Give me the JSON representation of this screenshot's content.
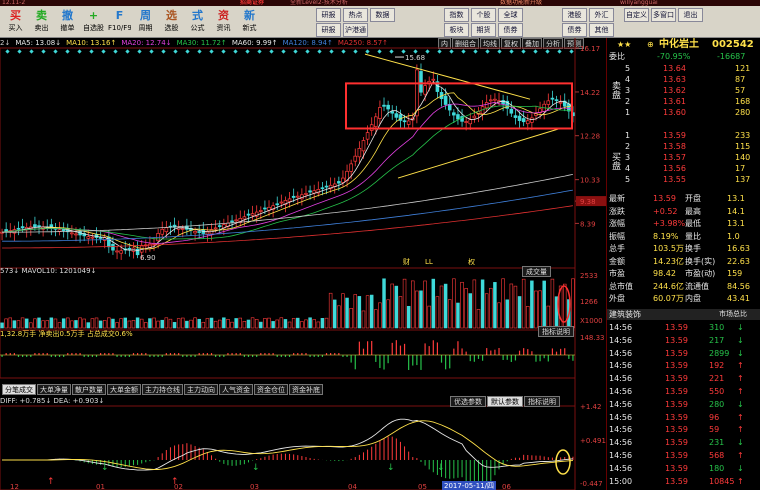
{
  "titlebar": {
    "left": "12.11-2",
    "brand": "招商证券",
    "app_name": "全新Level2-技术分析",
    "center_text": "数据功能新升级",
    "user": "willyangguai"
  },
  "menu": [
    "交易",
    "智能",
    "工具",
    "资讯",
    "帮助"
  ],
  "toolbar": {
    "buttons": [
      {
        "label": "买入",
        "icon": "买"
      },
      {
        "label": "卖出",
        "icon": "卖"
      },
      {
        "label": "撤单",
        "icon": "撤"
      },
      {
        "label": "自选股",
        "icon": "+"
      },
      {
        "label": "F10/F9",
        "icon": "F"
      },
      {
        "label": "周期",
        "icon": "周"
      },
      {
        "label": "选股",
        "icon": "选"
      },
      {
        "label": "公式",
        "icon": "式"
      },
      {
        "label": "资讯",
        "icon": "资"
      },
      {
        "label": "新式",
        "icon": "新"
      }
    ],
    "group2": [
      "研报",
      "热点",
      "数据",
      "研报",
      "沪港通"
    ],
    "group3": [
      "指数",
      "个股",
      "全球",
      "板块",
      "期货",
      "债券"
    ],
    "group4": [
      "港股",
      "外汇",
      "债券",
      "其他"
    ],
    "group5": [
      "自定义",
      "多窗口",
      "退出"
    ],
    "news_label": "NEWS"
  },
  "chart": {
    "ma_legend": [
      {
        "text": "2↓",
        "color": "#cccccc"
      },
      {
        "text": "MA5: 13.08↓",
        "color": "#e8e8e8"
      },
      {
        "text": "MA10: 13.16↑",
        "color": "#ffe14a"
      },
      {
        "text": "MA20: 12.74↓",
        "color": "#e040e0"
      },
      {
        "text": "MA30: 11.72↑",
        "color": "#26c24a"
      },
      {
        "text": "MA60: 9.99↑",
        "color": "#e8e8e8"
      },
      {
        "text": "MA120: 8.94↑",
        "color": "#3f7fd9"
      },
      {
        "text": "MA250: 8.57↑",
        "color": "#e03030"
      }
    ],
    "top_right_tabs": [
      "内",
      "删组合",
      "均线",
      "复权",
      "叠加",
      "分析",
      "预测"
    ],
    "price_axis": [
      "16.17",
      "14.22",
      "12.28",
      "10.33",
      "9.38",
      "8.39"
    ],
    "price_marker": "9.38",
    "high_label": "15.68",
    "low_label": "6.90",
    "event_marks": [
      "财",
      "LL",
      "权"
    ],
    "vol_header": "573↓  MAVOL10: 1201049↓",
    "vol_tab": "成交量",
    "vol_axis": [
      "2533",
      "1266",
      "X1000"
    ],
    "indicator_btn": "指标说明",
    "flow_header": "1,32.8万手  净卖出0.5万手  占总成交0.6%",
    "flow_axis": [
      "148.33"
    ],
    "bottom_tabs": [
      "分笔成交",
      "大单净量",
      "散户数量",
      "大单金额",
      "主力持仓线",
      "主力动向",
      "人气资金",
      "资金仓位",
      "资金补底"
    ],
    "macd_header": "DIFF: +0.785↓  DEA: +0.903↓",
    "macd_tabs": [
      "优选参数",
      "默认参数",
      "指标说明"
    ],
    "macd_axis": [
      "+1.42",
      "+0.491",
      "-0.447"
    ],
    "x_axis": [
      "12",
      "01",
      "02",
      "03",
      "04",
      "05",
      "06"
    ],
    "cursor_date": "2017-05-11/四",
    "chart_data": {
      "type": "candlestick",
      "ylim": [
        6.5,
        16.17
      ],
      "annotations": [
        "15.68",
        "6.90"
      ]
    }
  },
  "quote": {
    "code": "002542",
    "name": "中化岩土",
    "ratio": {
      "label": "委比",
      "value": "-70.95%",
      "diff": "-16687"
    },
    "sell_label": "卖盘",
    "buy_label": "买盘",
    "asks": [
      {
        "lvl": "5",
        "price": "13.64",
        "vol": "121"
      },
      {
        "lvl": "4",
        "price": "13.63",
        "vol": "87"
      },
      {
        "lvl": "3",
        "price": "13.62",
        "vol": "57"
      },
      {
        "lvl": "2",
        "price": "13.61",
        "vol": "168"
      },
      {
        "lvl": "1",
        "price": "13.60",
        "vol": "280"
      }
    ],
    "bids": [
      {
        "lvl": "1",
        "price": "13.59",
        "vol": "233"
      },
      {
        "lvl": "2",
        "price": "13.58",
        "vol": "115"
      },
      {
        "lvl": "3",
        "price": "13.57",
        "vol": "140"
      },
      {
        "lvl": "4",
        "price": "13.56",
        "vol": "17"
      },
      {
        "lvl": "5",
        "price": "13.55",
        "vol": "137"
      }
    ],
    "stats": [
      {
        "k1": "最新",
        "v1": "13.59",
        "k2": "开盘",
        "v2": "13.1"
      },
      {
        "k1": "涨跌",
        "v1": "+0.52",
        "k2": "最高",
        "v2": "14.1"
      },
      {
        "k1": "涨幅",
        "v1": "+3.98%",
        "k2": "最低",
        "v2": "13.1"
      },
      {
        "k1": "振幅",
        "v1": "8.19%",
        "k2": "量比",
        "v2": "1.0"
      },
      {
        "k1": "总手",
        "v1": "103.5万",
        "k2": "换手",
        "v2": "16.63"
      },
      {
        "k1": "金额",
        "v1": "14.23亿",
        "k2": "换手(实)",
        "v2": "22.63"
      },
      {
        "k1": "市盈",
        "v1": "98.42",
        "k2": "市盈(动)",
        "v2": "159"
      },
      {
        "k1": "总市值",
        "v1": "244.6亿",
        "k2": "流通值",
        "v2": "84.56"
      },
      {
        "k1": "外盘",
        "v1": "60.07万",
        "k2": "内盘",
        "v2": "43.41"
      }
    ],
    "industry": "建筑装饰",
    "industry_right": "市场总比",
    "ticks": [
      {
        "t": "14:56",
        "p": "13.59",
        "v": "310",
        "d": "dn"
      },
      {
        "t": "14:56",
        "p": "13.59",
        "v": "217",
        "d": "dn"
      },
      {
        "t": "14:56",
        "p": "13.59",
        "v": "2899",
        "d": "dn"
      },
      {
        "t": "14:56",
        "p": "13.59",
        "v": "192",
        "d": "up"
      },
      {
        "t": "14:56",
        "p": "13.59",
        "v": "221",
        "d": "up"
      },
      {
        "t": "14:56",
        "p": "13.59",
        "v": "550",
        "d": "up"
      },
      {
        "t": "14:56",
        "p": "13.59",
        "v": "280",
        "d": "dn"
      },
      {
        "t": "14:56",
        "p": "13.59",
        "v": "96",
        "d": "up"
      },
      {
        "t": "14:56",
        "p": "13.59",
        "v": "59",
        "d": "up"
      },
      {
        "t": "14:56",
        "p": "13.59",
        "v": "231",
        "d": "dn"
      },
      {
        "t": "14:56",
        "p": "13.59",
        "v": "568",
        "d": "up"
      },
      {
        "t": "14:56",
        "p": "13.59",
        "v": "180",
        "d": "dn"
      },
      {
        "t": "15:00",
        "p": "13.59",
        "v": "10845",
        "d": "up"
      }
    ]
  },
  "colors": {
    "up": "#ff3b3b",
    "down": "#26c24a",
    "yellow": "#ffe14a",
    "cyan": "#3fd9d9"
  }
}
